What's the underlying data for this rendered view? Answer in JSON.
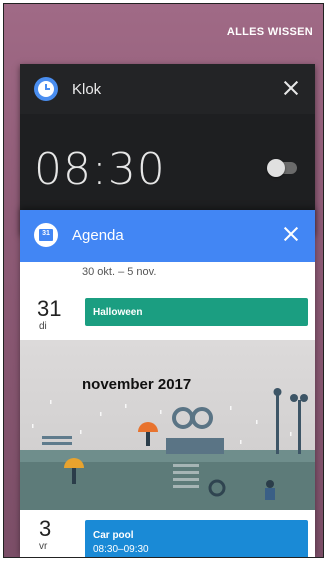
{
  "header": {
    "clear_all_label": "ALLES WISSEN"
  },
  "clock_card": {
    "app_name": "Klok",
    "icon": "clock-icon",
    "alarm_time": "08:30",
    "alarm_enabled": false
  },
  "agenda_card": {
    "app_name": "Agenda",
    "icon": "calendar-icon",
    "icon_day": "31",
    "week_range": "30 okt. – 5 nov.",
    "days": [
      {
        "num": "31",
        "name": "di",
        "event_title": "Halloween"
      },
      {
        "num": "3",
        "name": "vr",
        "event_title": "Car pool",
        "event_time": "08:30–09:30"
      }
    ],
    "month_banner": "november 2017"
  },
  "colors": {
    "agenda_header": "#4286f4",
    "halloween_event": "#1b9e81",
    "carpool_event": "#1a8ad6",
    "clock_card_bg": "#1e1f21"
  }
}
